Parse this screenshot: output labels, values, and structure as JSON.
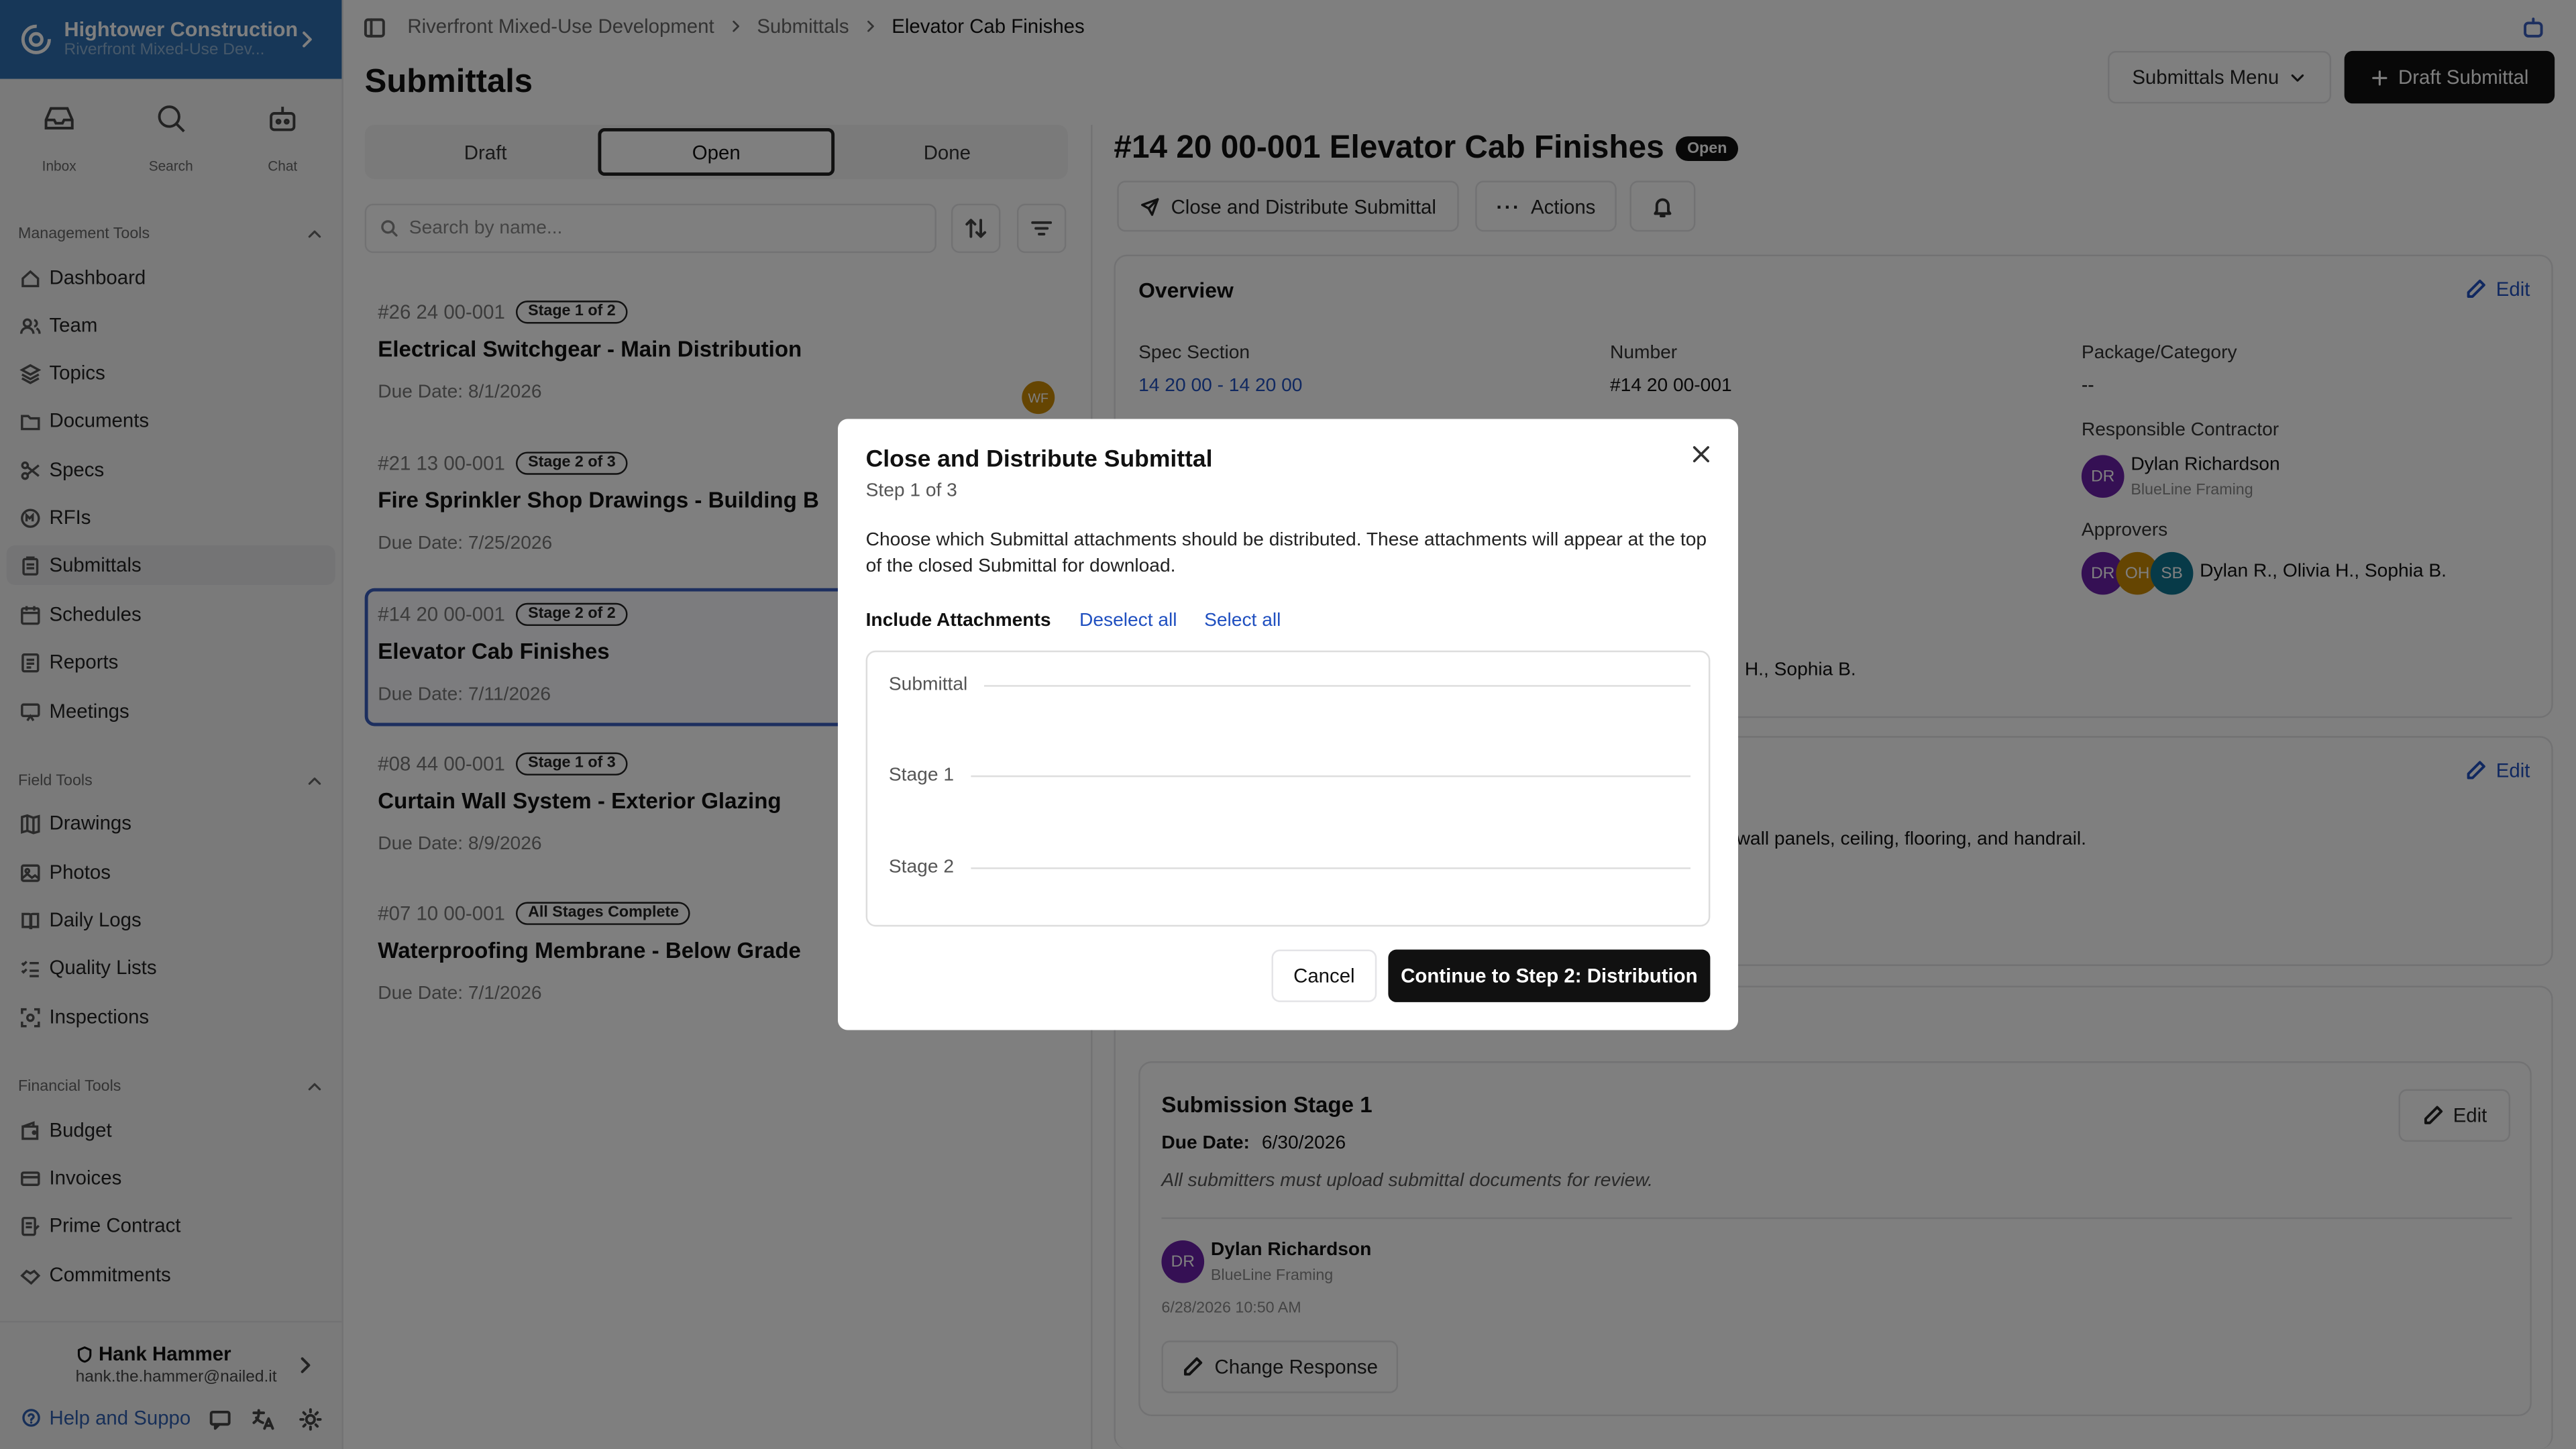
{
  "org": {
    "name": "Hightower Construction",
    "project": "Riverfront Mixed-Use Dev..."
  },
  "quick": [
    {
      "label": "Inbox",
      "icon": "inbox-icon"
    },
    {
      "label": "Search",
      "icon": "search-icon"
    },
    {
      "label": "Chat",
      "icon": "bot-icon"
    }
  ],
  "sections": {
    "management": "Management Tools",
    "field": "Field Tools",
    "financial": "Financial Tools"
  },
  "nav": {
    "management": [
      "Dashboard",
      "Team",
      "Topics",
      "Documents",
      "Specs",
      "RFIs",
      "Submittals",
      "Schedules",
      "Reports",
      "Meetings"
    ],
    "field": [
      "Drawings",
      "Photos",
      "Daily Logs",
      "Quality Lists",
      "Inspections"
    ],
    "financial": [
      "Budget",
      "Invoices",
      "Prime Contract",
      "Commitments"
    ],
    "active": "Submittals"
  },
  "user": {
    "name": "Hank Hammer",
    "email": "hank.the.hammer@nailed.it",
    "help": "Help and Suppo"
  },
  "breadcrumb": [
    "Riverfront Mixed-Use Development",
    "Submittals",
    "Elevator Cab Finishes"
  ],
  "page_title": "Submittals",
  "header_buttons": {
    "menu": "Submittals Menu",
    "draft": "Draft Submittal"
  },
  "tabs": [
    "Draft",
    "Open",
    "Done"
  ],
  "active_tab": "Open",
  "search_placeholder": "Search by name...",
  "submittals": [
    {
      "number": "#26 24 00-001",
      "stage": "Stage 1 of 2",
      "title": "Electrical Switchgear - Main Distribution",
      "due": "Due Date: 8/1/2026",
      "avatar": "WF"
    },
    {
      "number": "#21 13 00-001",
      "stage": "Stage 2 of 3",
      "title": "Fire Sprinkler Shop Drawings - Building B",
      "due": "Due Date: 7/25/2026"
    },
    {
      "number": "#14 20 00-001",
      "stage": "Stage 2 of 2",
      "title": "Elevator Cab Finishes",
      "due": "Due Date: 7/11/2026"
    },
    {
      "number": "#08 44 00-001",
      "stage": "Stage 1 of 3",
      "title": "Curtain Wall System - Exterior Glazing",
      "due": "Due Date: 8/9/2026"
    },
    {
      "number": "#07 10 00-001",
      "stage": "All Stages Complete",
      "title": "Waterproofing Membrane - Below Grade",
      "due": "Due Date: 7/1/2026"
    }
  ],
  "detail": {
    "title": "#14 20 00-001 Elevator Cab Finishes",
    "status": "Open",
    "close_btn": "Close and Distribute Submittal",
    "actions_btn": "Actions",
    "overview": "Overview",
    "edit": "Edit",
    "spec_label": "Spec Section",
    "spec_value": "14 20 00 - 14 20 00",
    "number_label": "Number",
    "number_value": "#14 20 00-001",
    "package_label": "Package/Category",
    "package_value": "--",
    "contractor_label": "Responsible Contractor",
    "contractor_name": "Dylan Richardson",
    "contractor_company": "BlueLine Framing",
    "approvers_label": "Approvers",
    "approvers": "Dylan R., Olivia H., Sophia B.",
    "approver_initials": [
      "DR",
      "OH",
      "SB"
    ],
    "behind_approvers": "H., Sophia B.",
    "behind_desc": "wall panels, ceiling, flooring, and handrail.",
    "stage_title": "Submission Stage 1",
    "stage_due_label": "Due Date:",
    "stage_due": "6/30/2026",
    "stage_note": "All submitters must upload submittal documents for review.",
    "resp_name": "Dylan Richardson",
    "resp_company": "BlueLine Framing",
    "resp_time": "6/28/2026 10:50 AM",
    "change_response": "Change Response",
    "initials": "DR"
  },
  "modal": {
    "title": "Close and Distribute Submittal",
    "step": "Step 1 of 3",
    "description": "Choose which Submittal attachments should be distributed. These attachments will appear at the top of the closed Submittal for download.",
    "include_label": "Include Attachments",
    "deselect": "Deselect all",
    "select": "Select all",
    "groups": [
      "Submittal",
      "Stage 1",
      "Stage 2"
    ],
    "cancel": "Cancel",
    "continue": "Continue to Step 2: Distribution"
  },
  "colors": {
    "brand": "#2f6fb0",
    "primary": "#111111",
    "link": "#2050c0",
    "avatar_dr": "#6b21a8",
    "avatar_oh": "#ca8a04",
    "avatar_sb": "#0e7490"
  }
}
